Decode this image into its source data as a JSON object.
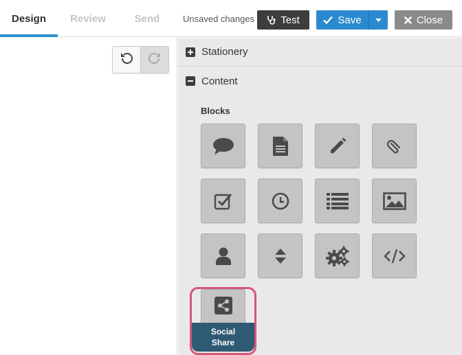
{
  "tabs": [
    {
      "label": "Design",
      "active": true
    },
    {
      "label": "Review",
      "active": false
    },
    {
      "label": "Send",
      "active": false
    }
  ],
  "status": {
    "unsaved_text": "Unsaved changes"
  },
  "toolbar": {
    "test_label": "Test",
    "save_label": "Save",
    "close_label": "Close"
  },
  "history": {
    "undo_icon": "undo-icon",
    "redo_icon": "redo-icon"
  },
  "panel": {
    "sections": [
      {
        "label": "Stationery",
        "state": "collapsed"
      },
      {
        "label": "Content",
        "state": "expanded"
      }
    ],
    "blocks_title": "Blocks",
    "blocks": [
      {
        "icon": "speech-bubble-icon"
      },
      {
        "icon": "document-icon"
      },
      {
        "icon": "pencil-icon"
      },
      {
        "icon": "paperclip-icon"
      },
      {
        "icon": "checkbox-icon"
      },
      {
        "icon": "clock-icon"
      },
      {
        "icon": "list-icon"
      },
      {
        "icon": "image-icon"
      },
      {
        "icon": "person-icon"
      },
      {
        "icon": "spacer-icon"
      },
      {
        "icon": "gears-icon"
      },
      {
        "icon": "code-icon"
      }
    ],
    "social_share": {
      "label_line1": "Social",
      "label_line2": "Share",
      "icon": "share-icon"
    }
  },
  "colors": {
    "accent": "#2a8ad0",
    "highlight": "#d6557a",
    "tooltip": "#2f5a73",
    "block_bg": "#c4c4c4",
    "icon": "#4a4a4a"
  }
}
